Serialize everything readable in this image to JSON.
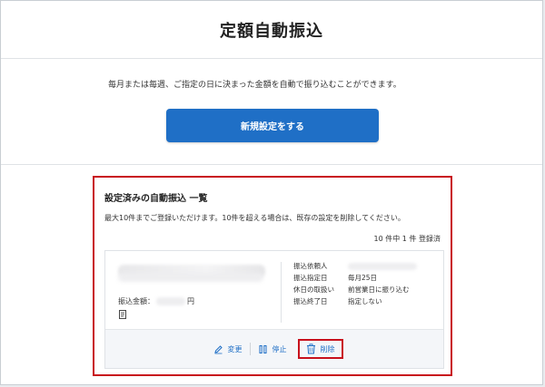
{
  "page": {
    "title": "定額自動振込"
  },
  "intro": {
    "description": "毎月または毎週、ご指定の日に決まった金額を自動で振り込むことができます。",
    "new_button": "新規設定をする"
  },
  "registered": {
    "title": "設定済みの自動振込 一覧",
    "note": "最大10件までご登録いただけます。10件を超える場合は、既存の設定を削除してください。",
    "count": "10 件中 1 件 登録済",
    "card": {
      "amount_label": "振込金額：",
      "amount_unit": "円",
      "memo_icon": "memo-icon",
      "info": [
        {
          "key": "振込依頼人",
          "value": ""
        },
        {
          "key": "振込指定日",
          "value": "毎月25日"
        },
        {
          "key": "休日の取扱い",
          "value": "前営業日に振り込む"
        },
        {
          "key": "振込終了日",
          "value": "指定しない"
        }
      ],
      "actions": {
        "edit": {
          "label": "変更",
          "icon": "pencil-icon"
        },
        "stop": {
          "label": "停止",
          "icon": "pause-icon"
        },
        "delete": {
          "label": "削除",
          "icon": "trash-icon"
        }
      }
    }
  },
  "colors": {
    "accent": "#1f6fc6",
    "highlight": "#c8101c"
  }
}
